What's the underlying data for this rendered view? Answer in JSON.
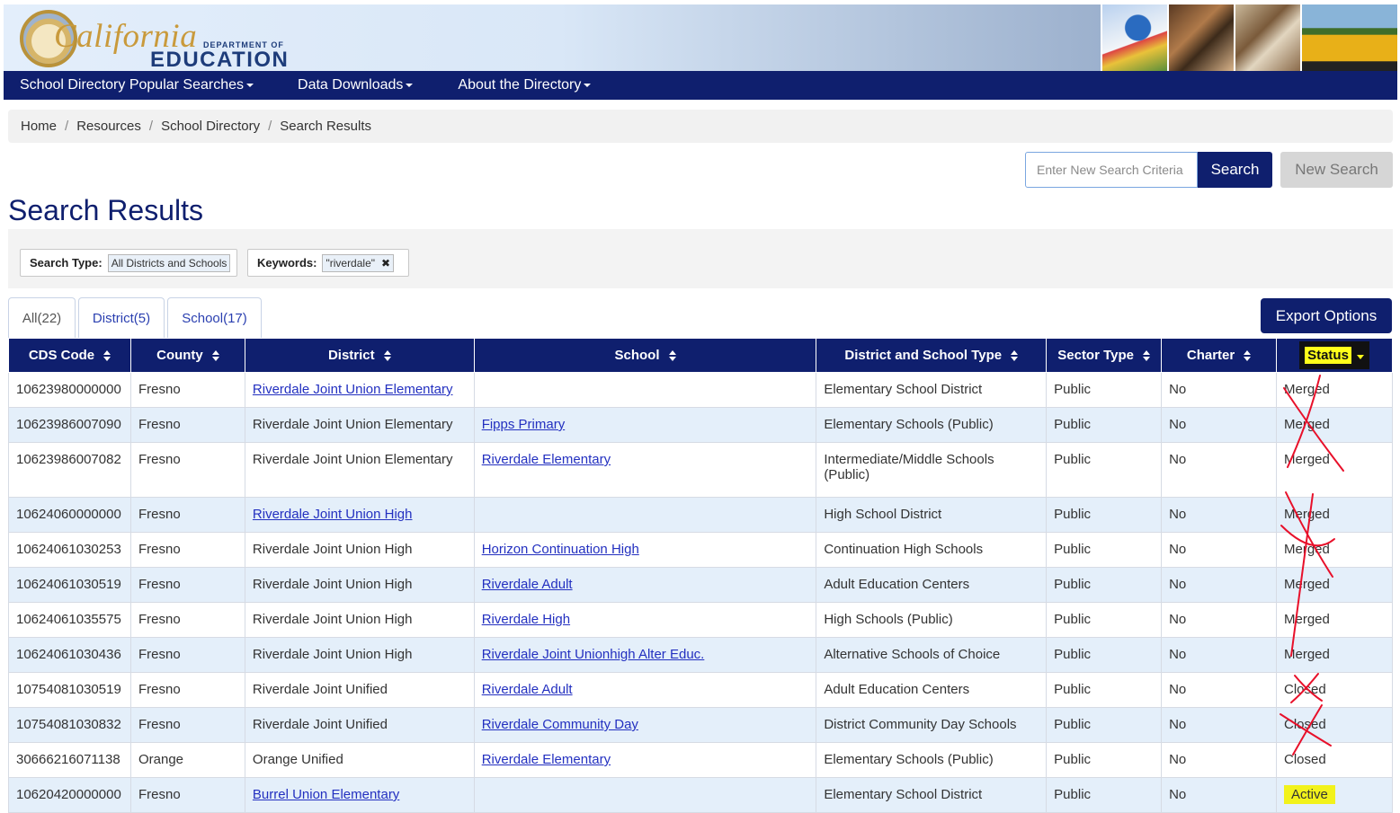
{
  "header": {
    "logo_script": "California",
    "logo_dept": "DEPARTMENT OF",
    "logo_edu": "EDUCATION"
  },
  "nav": {
    "items": [
      {
        "label": "School Directory Popular Searches"
      },
      {
        "label": "Data Downloads"
      },
      {
        "label": "About the Directory"
      }
    ]
  },
  "breadcrumb": [
    "Home",
    "Resources",
    "School Directory",
    "Search Results"
  ],
  "search": {
    "placeholder": "Enter New Search Criteria",
    "search_label": "Search",
    "new_search_label": "New Search"
  },
  "page_title": "Search Results",
  "filters": {
    "search_type_label": "Search Type:",
    "search_type_value": "All Districts and Schools",
    "keywords_label": "Keywords:",
    "keywords_value": "\"riverdale\"",
    "remove_glyph": "✖"
  },
  "tabs": [
    {
      "label": "All(22)"
    },
    {
      "label": "District(5)"
    },
    {
      "label": "School(17)"
    }
  ],
  "export_label": "Export Options",
  "table": {
    "columns": [
      "CDS Code",
      "County",
      "District",
      "School",
      "District and School Type",
      "Sector Type",
      "Charter",
      "Status"
    ],
    "rows": [
      {
        "cds": "10623980000000",
        "county": "Fresno",
        "district": "Riverdale Joint Union Elementary",
        "school": "",
        "type": "Elementary School District",
        "sector": "Public",
        "charter": "No",
        "status": "Merged"
      },
      {
        "cds": "10623986007090",
        "county": "Fresno",
        "district": "Riverdale Joint Union Elementary",
        "school": "Fipps Primary",
        "type": "Elementary Schools (Public)",
        "sector": "Public",
        "charter": "No",
        "status": "Merged"
      },
      {
        "cds": "10623986007082",
        "county": "Fresno",
        "district": "Riverdale Joint Union Elementary",
        "school": "Riverdale Elementary",
        "type": "Intermediate/Middle Schools (Public)",
        "sector": "Public",
        "charter": "No",
        "status": "Merged"
      },
      {
        "cds": "10624060000000",
        "county": "Fresno",
        "district": "Riverdale Joint Union High",
        "school": "",
        "type": "High School District",
        "sector": "Public",
        "charter": "No",
        "status": "Merged"
      },
      {
        "cds": "10624061030253",
        "county": "Fresno",
        "district": "Riverdale Joint Union High",
        "school": "Horizon Continuation High",
        "type": "Continuation High Schools",
        "sector": "Public",
        "charter": "No",
        "status": "Merged"
      },
      {
        "cds": "10624061030519",
        "county": "Fresno",
        "district": "Riverdale Joint Union High",
        "school": "Riverdale Adult",
        "type": "Adult Education Centers",
        "sector": "Public",
        "charter": "No",
        "status": "Merged"
      },
      {
        "cds": "10624061035575",
        "county": "Fresno",
        "district": "Riverdale Joint Union High",
        "school": "Riverdale High",
        "type": "High Schools (Public)",
        "sector": "Public",
        "charter": "No",
        "status": "Merged"
      },
      {
        "cds": "10624061030436",
        "county": "Fresno",
        "district": "Riverdale Joint Union High",
        "school": "Riverdale Joint Unionhigh Alter Educ.",
        "type": "Alternative Schools of Choice",
        "sector": "Public",
        "charter": "No",
        "status": "Merged"
      },
      {
        "cds": "10754081030519",
        "county": "Fresno",
        "district": "Riverdale Joint Unified",
        "school": "Riverdale Adult",
        "type": "Adult Education Centers",
        "sector": "Public",
        "charter": "No",
        "status": "Closed"
      },
      {
        "cds": "10754081030832",
        "county": "Fresno",
        "district": "Riverdale Joint Unified",
        "school": "Riverdale Community Day",
        "type": "District Community Day Schools",
        "sector": "Public",
        "charter": "No",
        "status": "Closed"
      },
      {
        "cds": "30666216071138",
        "county": "Orange",
        "district": "Orange Unified",
        "school": "Riverdale Elementary",
        "type": "Elementary Schools (Public)",
        "sector": "Public",
        "charter": "No",
        "status": "Closed"
      },
      {
        "cds": "10620420000000",
        "county": "Fresno",
        "district": "Burrel Union Elementary",
        "school": "",
        "type": "Elementary School District",
        "sector": "Public",
        "charter": "No",
        "status": "Active"
      }
    ]
  },
  "colors": {
    "navy": "#0f1f6e",
    "link": "#2330c0",
    "row_alt": "#e4effa",
    "highlight": "#f2f21b",
    "annotation_red": "#e8102a"
  }
}
